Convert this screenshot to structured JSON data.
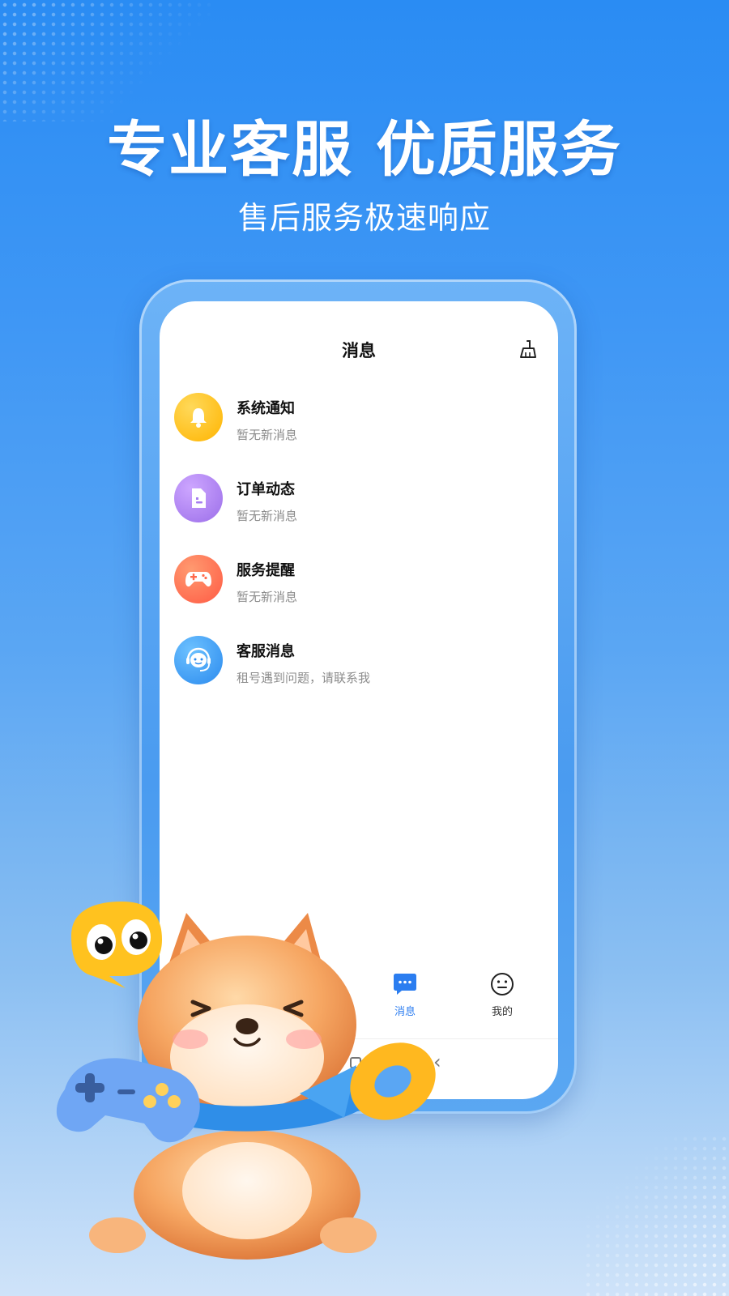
{
  "promo": {
    "headline": "专业客服 优质服务",
    "subheadline": "售后服务极速响应"
  },
  "screen": {
    "title": "消息",
    "clear_icon": "broom-icon",
    "messages": [
      {
        "title": "系统通知",
        "subtitle": "暂无新消息",
        "icon": "bell-icon",
        "color": "#ffbe1a"
      },
      {
        "title": "订单动态",
        "subtitle": "暂无新消息",
        "icon": "document-icon",
        "color": "#b083f2"
      },
      {
        "title": "服务提醒",
        "subtitle": "暂无新消息",
        "icon": "gamepad-icon",
        "color": "#ff6c4f"
      },
      {
        "title": "客服消息",
        "subtitle": "租号遇到问题，请联系我",
        "icon": "headset-icon",
        "color": "#3a9bf3"
      }
    ],
    "tabs": [
      {
        "label": "消息",
        "icon": "chat-bubble-icon",
        "active": true
      },
      {
        "label": "我的",
        "icon": "smiley-icon",
        "active": false
      }
    ],
    "accent_color": "#2b7df0"
  }
}
